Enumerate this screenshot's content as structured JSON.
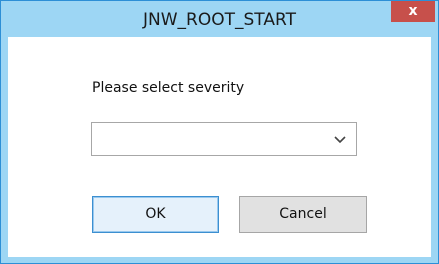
{
  "window": {
    "title": "JNW_ROOT_START",
    "close_glyph": "x",
    "accent_color": "#9dd6f4",
    "close_color": "#c7504b"
  },
  "dialog": {
    "prompt": "Please select severity",
    "severity_select": {
      "value": "",
      "icon": "chevron-down-icon"
    },
    "ok_label": "OK",
    "cancel_label": "Cancel"
  }
}
